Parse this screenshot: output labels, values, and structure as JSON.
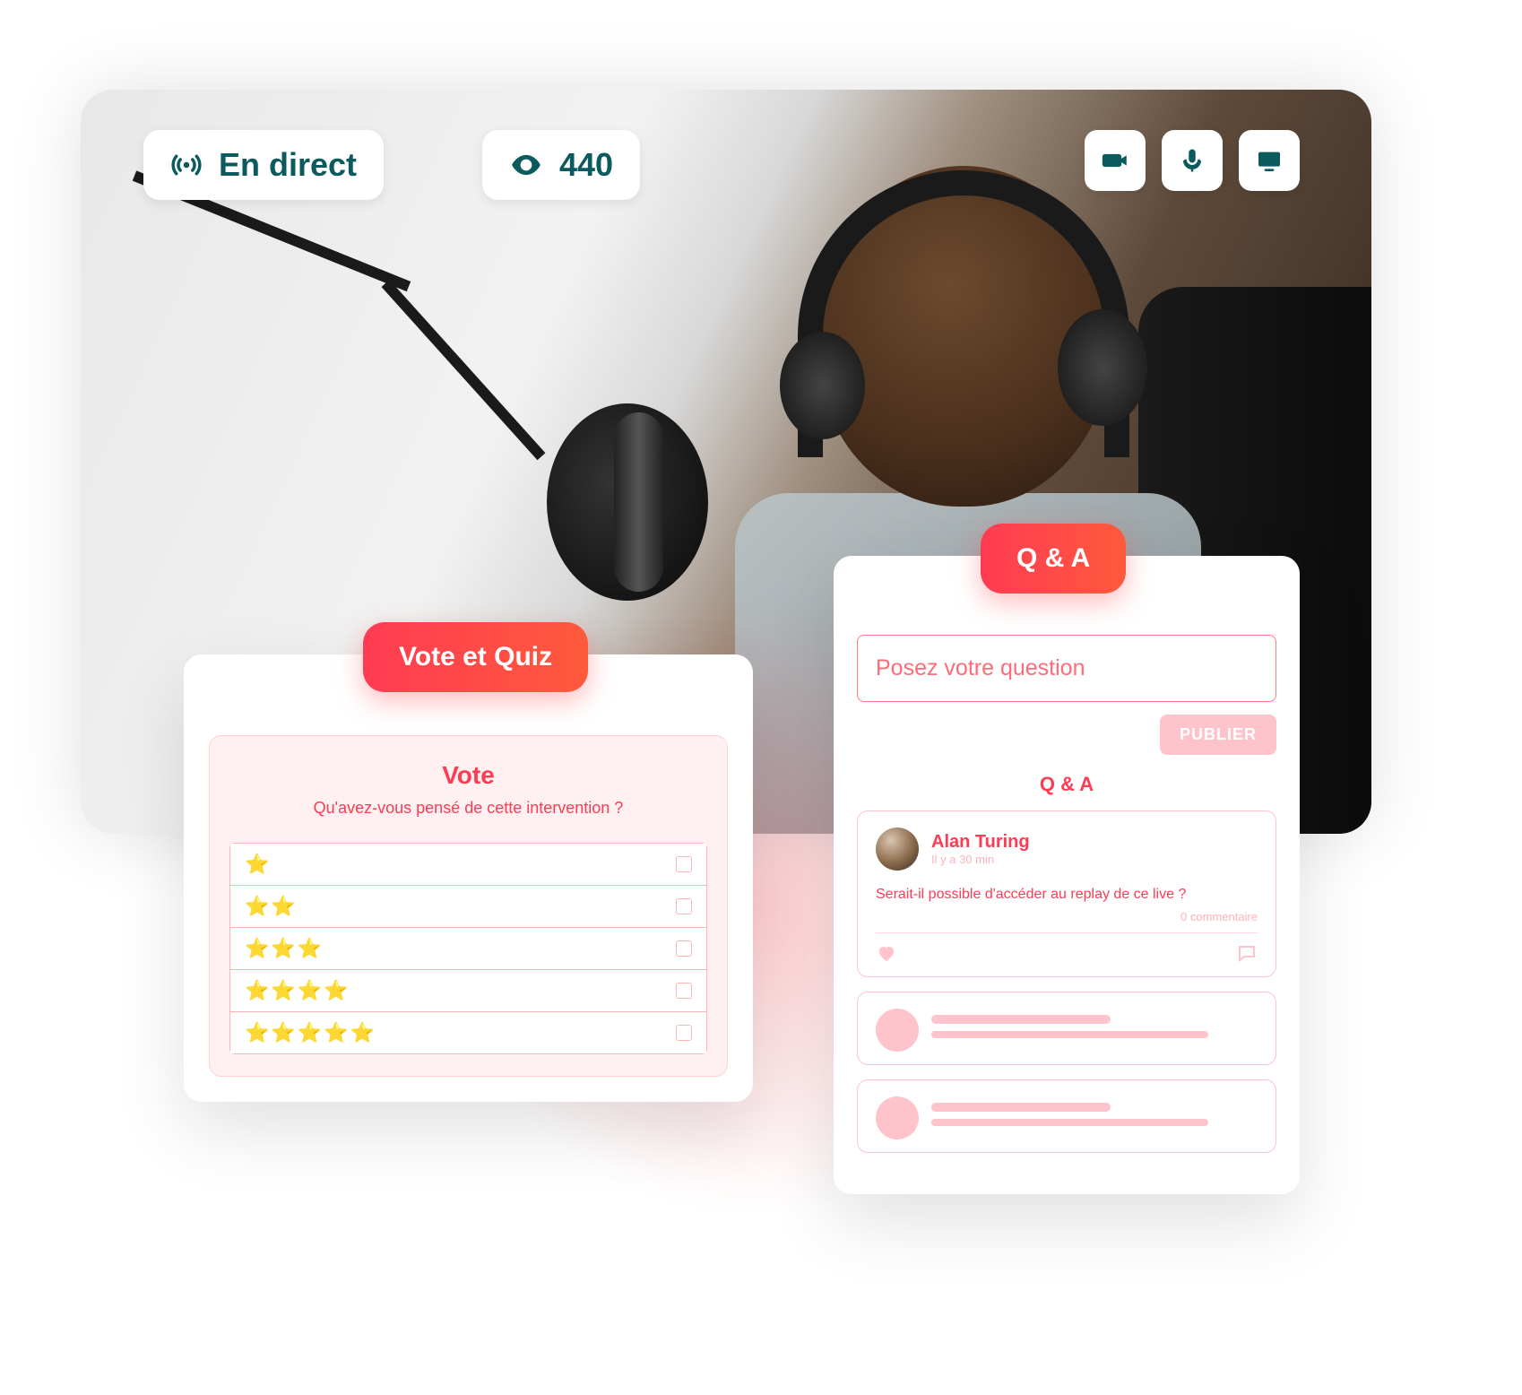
{
  "colors": {
    "teal": "#0a5a5e",
    "accent": "#ff3b53"
  },
  "live": {
    "label": "En direct",
    "icon": "broadcast-icon"
  },
  "viewers": {
    "count": "440",
    "icon": "eye-icon"
  },
  "controls": {
    "camera": "camera-icon",
    "mic": "microphone-icon",
    "screen": "screen-icon"
  },
  "vote": {
    "tab_label": "Vote et Quiz",
    "title": "Vote",
    "question": "Qu'avez-vous pensé de cette intervention ?",
    "options_stars": [
      1,
      2,
      3,
      4,
      5
    ]
  },
  "qa": {
    "tab_label": "Q & A",
    "input_placeholder": "Posez votre question",
    "publish_label": "PUBLIER",
    "section_title": "Q & A",
    "item": {
      "author": "Alan Turing",
      "timestamp": "Il y a 30 min",
      "question": "Serait-il possible d'accéder au replay de ce live ?",
      "comment_count": "0 commentaire"
    }
  }
}
